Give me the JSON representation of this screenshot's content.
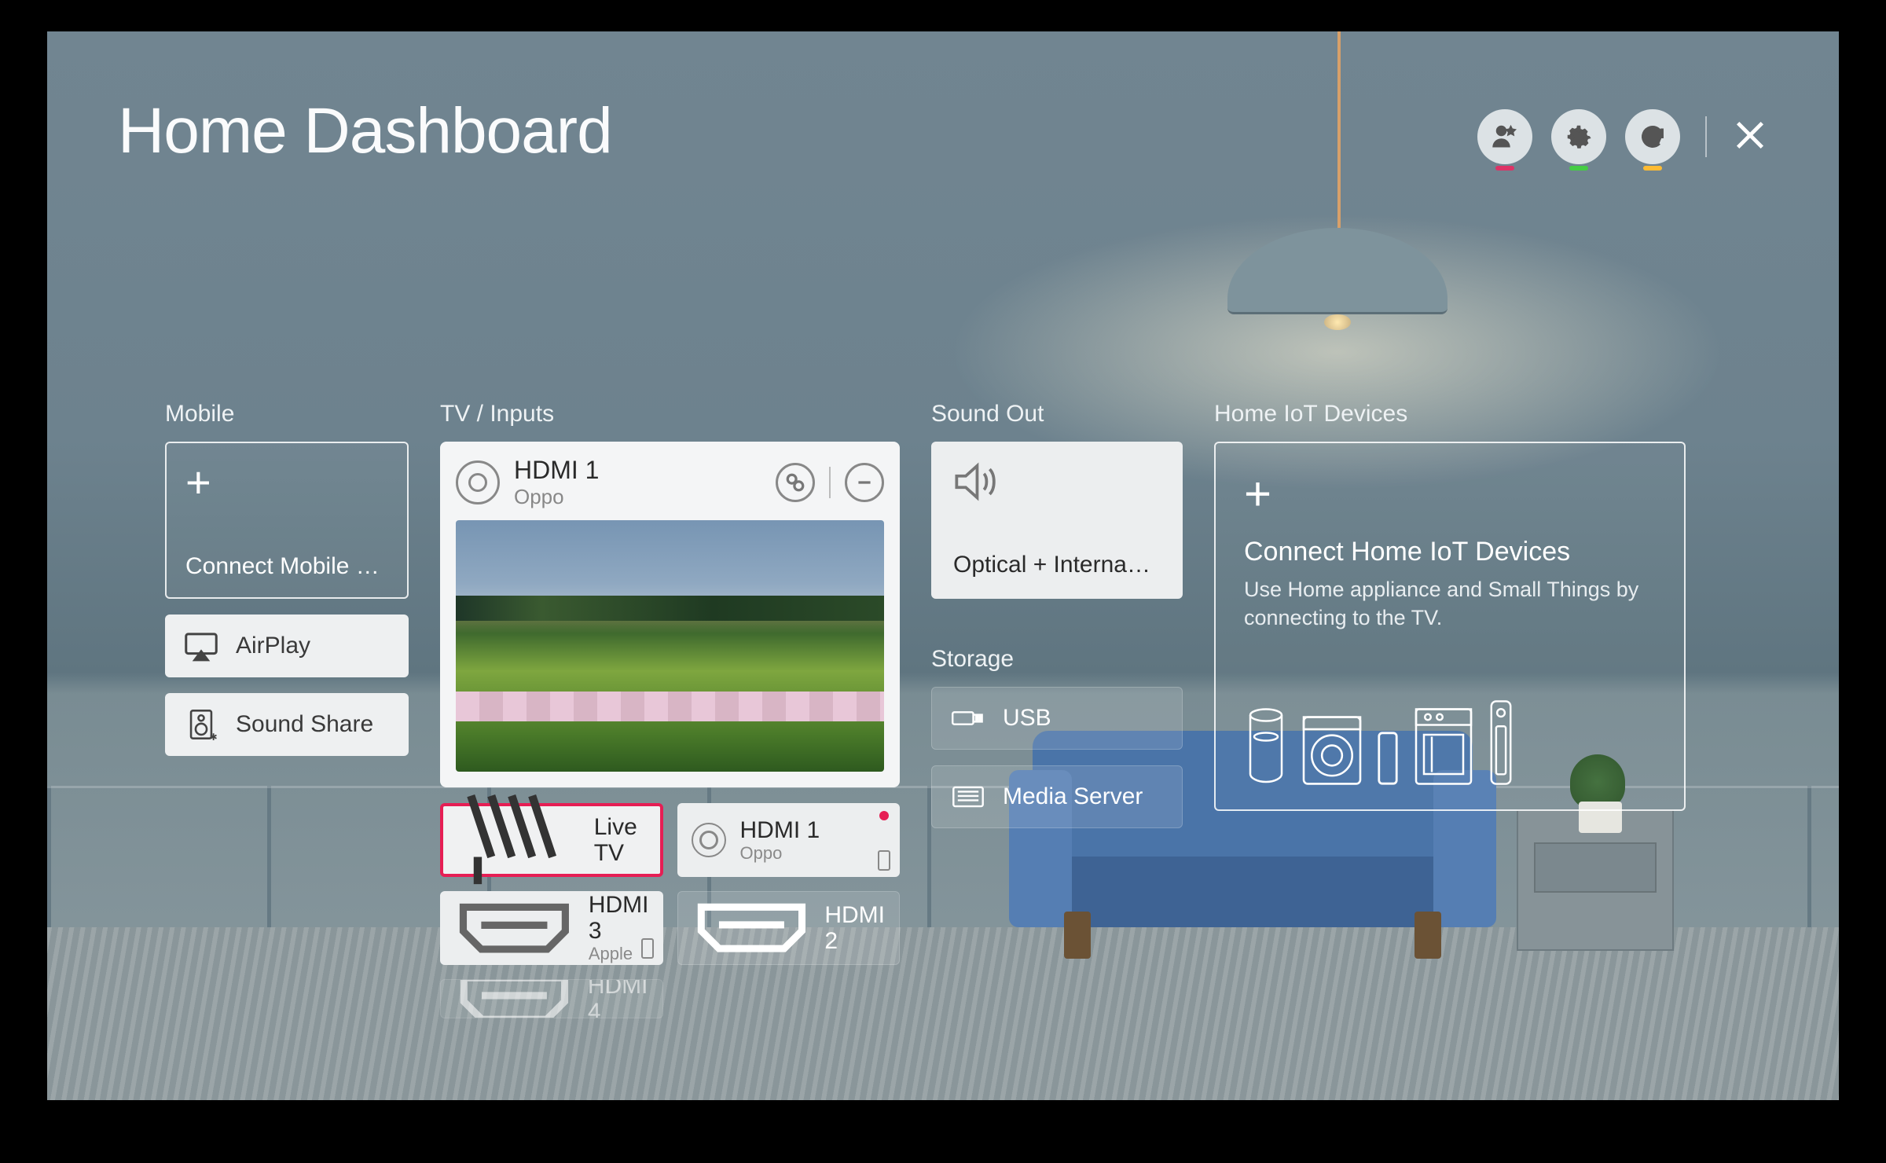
{
  "header": {
    "title": "Home Dashboard",
    "actions": {
      "account": "account",
      "settings": "settings",
      "refresh": "refresh",
      "close": "close"
    }
  },
  "mobile": {
    "label": "Mobile",
    "connect_label": "Connect Mobile …",
    "airplay": "AirPlay",
    "sound_share": "Sound Share"
  },
  "tv": {
    "label": "TV / Inputs",
    "preview": {
      "title": "HDMI 1",
      "subtitle": "Oppo"
    },
    "inputs": [
      {
        "id": "live-tv",
        "title": "Live TV",
        "sub": "",
        "style": "selected"
      },
      {
        "id": "hdmi-1",
        "title": "HDMI 1",
        "sub": "Oppo",
        "style": "white",
        "dot": true,
        "remote": true
      },
      {
        "id": "hdmi-3",
        "title": "HDMI 3",
        "sub": "Apple",
        "style": "white",
        "remote": true
      },
      {
        "id": "hdmi-2",
        "title": "HDMI 2",
        "sub": "",
        "style": "trans"
      },
      {
        "id": "hdmi-4",
        "title": "HDMI 4",
        "sub": "",
        "style": "trans cut"
      }
    ]
  },
  "sound": {
    "label": "Sound Out",
    "output": "Optical + Interna…"
  },
  "storage": {
    "label": "Storage",
    "usb": "USB",
    "media_server": "Media Server"
  },
  "iot": {
    "label": "Home IoT Devices",
    "title": "Connect Home IoT Devices",
    "desc": "Use Home appliance and Small Things by connecting to the TV."
  }
}
